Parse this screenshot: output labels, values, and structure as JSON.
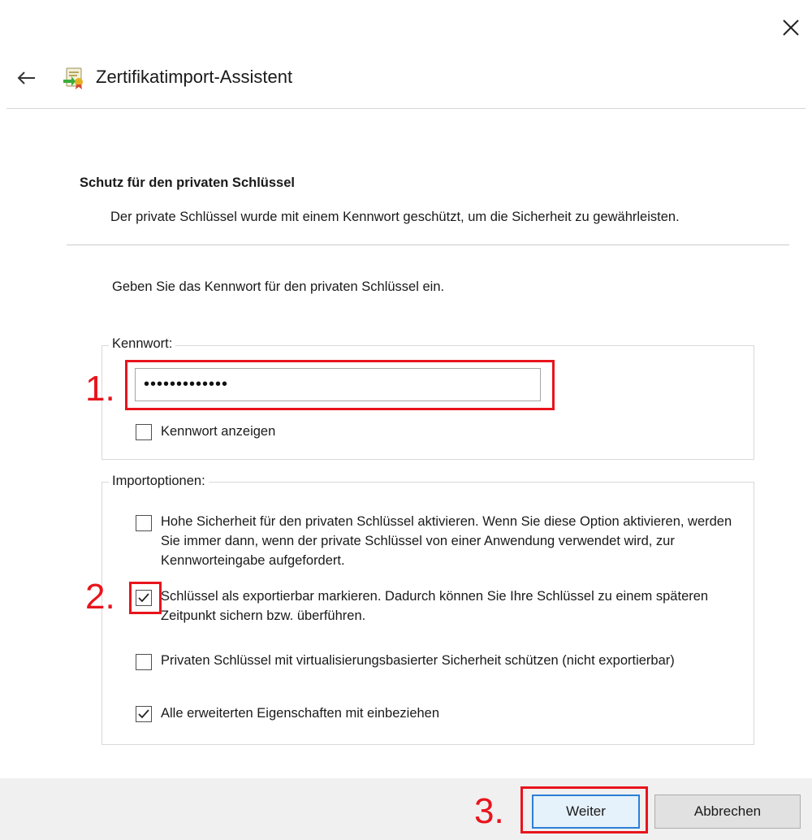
{
  "window": {
    "title": "Zertifikatimport-Assistent",
    "icons": [
      "back-arrow-icon",
      "certificate-import-icon",
      "close-icon"
    ]
  },
  "header": {
    "title": "Schutz für den privaten Schlüssel",
    "description": "Der private Schlüssel wurde mit einem Kennwort geschützt, um die Sicherheit zu gewährleisten."
  },
  "instruction": "Geben Sie das Kennwort für den privaten Schlüssel ein.",
  "password_group": {
    "label": "Kennwort:",
    "value_masked": "•••••••••••••",
    "show_password": {
      "label": "Kennwort anzeigen",
      "checked": false
    }
  },
  "import_options": {
    "label": "Importoptionen:",
    "options": [
      {
        "label": "Hohe Sicherheit für den privaten Schlüssel aktivieren. Wenn Sie diese Option aktivieren, werden Sie immer dann, wenn der private Schlüssel von einer Anwendung verwendet wird, zur Kennworteingabe aufgefordert.",
        "checked": false
      },
      {
        "label": "Schlüssel als exportierbar markieren. Dadurch können Sie Ihre Schlüssel zu einem späteren Zeitpunkt sichern bzw. überführen.",
        "checked": true
      },
      {
        "label": "Privaten Schlüssel mit virtualisierungsbasierter Sicherheit schützen (nicht exportierbar)",
        "checked": false
      },
      {
        "label": "Alle erweiterten Eigenschaften mit einbeziehen",
        "checked": true
      }
    ]
  },
  "annotations": {
    "step1": "1.",
    "step2": "2.",
    "step3": "3.",
    "color": "#e8141c"
  },
  "buttons": {
    "next": "Weiter",
    "cancel": "Abbrechen"
  },
  "colors": {
    "primary_button_border": "#2c7fd8",
    "footer_background": "#f0f0f0"
  }
}
